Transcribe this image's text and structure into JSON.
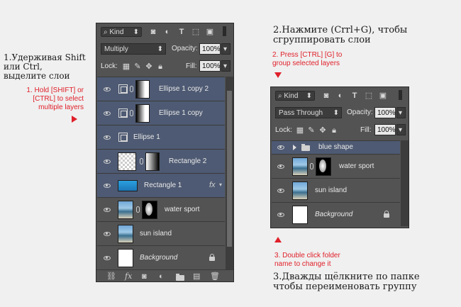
{
  "annotations": {
    "step1_ru": [
      "1.Удерживая Shift",
      "или Ctrl,",
      "выделите слои"
    ],
    "step1_en": [
      "1. Hold [SHIFT] or",
      "[CTRL] to select",
      "multiple layers"
    ],
    "step2_ru": [
      "2.Нажмите (Crrl+G), чтобы",
      "сгруппировать слои"
    ],
    "step2_en": [
      "2. Press [CTRL] [G] to",
      "group selected layers"
    ],
    "step3_en": [
      "3. Double click folder",
      "name to change it"
    ],
    "step3_ru": [
      "3.Дважды щёлкните по папке",
      "чтобы переименовать группу"
    ],
    "accent_color": "#e0202a"
  },
  "panel1": {
    "filter": "Kind",
    "blend_mode": "Multiply",
    "opacity_label": "Opacity:",
    "opacity": "100%",
    "lock_label": "Lock:",
    "fill_label": "Fill:",
    "fill": "100%",
    "layers": [
      {
        "name": "Ellipse 1 copy 2",
        "selected": true
      },
      {
        "name": "Ellipse 1 copy",
        "selected": true
      },
      {
        "name": "Ellipse 1",
        "selected": true
      },
      {
        "name": "Rectangle 2",
        "selected": true
      },
      {
        "name": "Rectangle 1",
        "selected": true,
        "fx": "fx"
      },
      {
        "name": "water sport",
        "selected": false
      },
      {
        "name": "sun island",
        "selected": false
      },
      {
        "name": "Background",
        "selected": false,
        "locked": true
      }
    ],
    "selection_color": "#4e5a73"
  },
  "panel2": {
    "filter": "Kind",
    "blend_mode": "Pass Through",
    "opacity_label": "Opacity:",
    "opacity": "100%",
    "lock_label": "Lock:",
    "fill_label": "Fill:",
    "fill": "100%",
    "layers": [
      {
        "name": "blue shape",
        "type": "group",
        "selected": true
      },
      {
        "name": "water sport",
        "selected": false
      },
      {
        "name": "sun island",
        "selected": false
      },
      {
        "name": "Background",
        "selected": false,
        "locked": true
      }
    ]
  }
}
